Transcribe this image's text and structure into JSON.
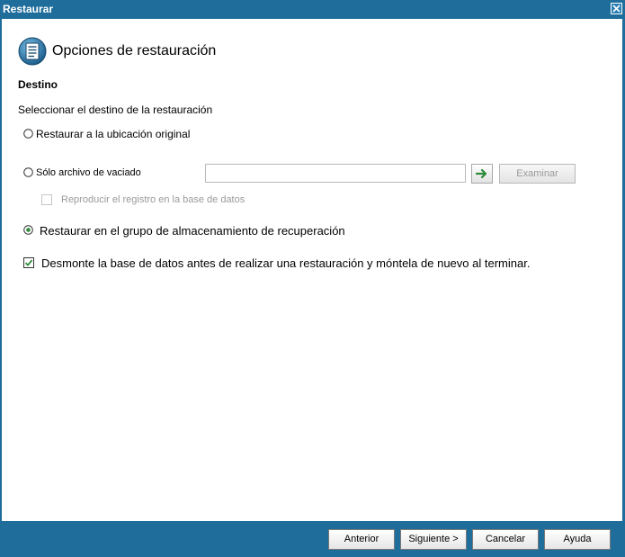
{
  "window": {
    "title": "Restaurar"
  },
  "header": {
    "title": "Opciones de restauración"
  },
  "section": {
    "title": "Destino",
    "description": "Seleccionar el destino de la restauración"
  },
  "options": {
    "original_location": {
      "label": "Restaurar a la ubicación original",
      "selected": false
    },
    "dump_file_only": {
      "label": "Sólo archivo de vaciado",
      "selected": false,
      "path_value": "",
      "browse_label": "Examinar",
      "replay_log_label": "Reproducir el registro en la base de datos",
      "replay_log_checked": false
    },
    "recovery_storage_group": {
      "label": "Restaurar en el grupo de almacenamiento de recuperación",
      "selected": true
    },
    "dismount_db": {
      "label": "Desmonte la base de datos antes de realizar una restauración y móntela de nuevo al terminar.",
      "checked": true
    }
  },
  "footer": {
    "back_label": "Anterior",
    "next_label": "Siguiente >",
    "cancel_label": "Cancelar",
    "help_label": "Ayuda"
  },
  "colors": {
    "frame": "#1f6d9b",
    "accent": "#2e8b3a"
  },
  "icons": {
    "header": "document-list-icon",
    "go": "arrow-right-icon",
    "close": "close-icon"
  }
}
